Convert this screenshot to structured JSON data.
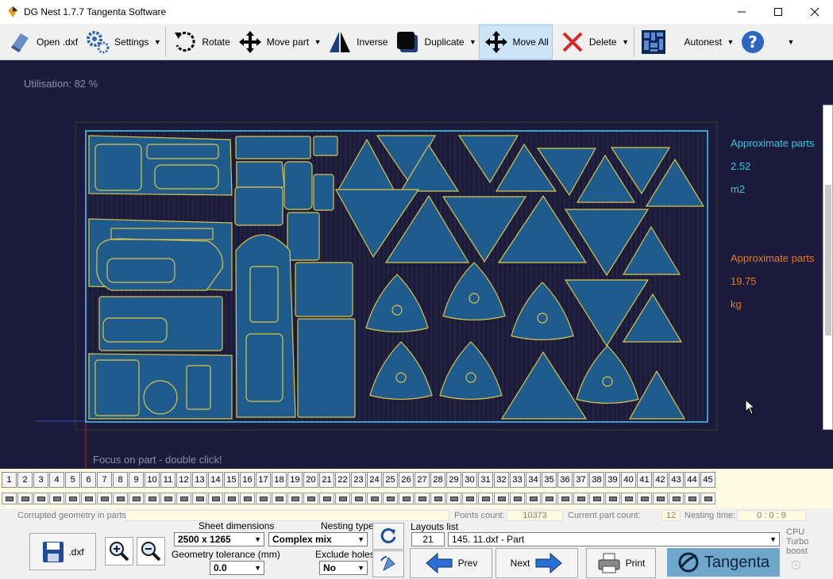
{
  "window": {
    "title": "DG Nest 1.7.7   Tangenta Software",
    "minimize_icon": "minimize-icon",
    "maximize_icon": "maximize-icon",
    "close_icon": "close-icon"
  },
  "toolbar": {
    "open_label": "Open .dxf",
    "settings_label": "Settings",
    "rotate_label": "Rotate",
    "move_part_label": "Move part",
    "inverse_label": "Inverse",
    "duplicate_label": "Duplicate",
    "move_all_label": "Move All",
    "delete_label": "Delete",
    "autonest_label": "Autonest"
  },
  "canvas": {
    "utilisation": "Utilisation: 82 %",
    "focus_hint": "Focus on part - double click!",
    "area_label": "Approximate parts",
    "area_value": "2.52",
    "area_unit": "m2",
    "weight_label": "Approximate parts",
    "weight_value": "19.75",
    "weight_unit": "kg",
    "colors": {
      "background": "#1c1b3b",
      "sheet": "#3ba1c9",
      "part_fill": "#1f5c8d",
      "part_outline": "#d9c64a"
    }
  },
  "layouts": {
    "tabs": [
      "1",
      "2",
      "3",
      "4",
      "5",
      "6",
      "7",
      "8",
      "9",
      "10",
      "11",
      "12",
      "13",
      "14",
      "15",
      "16",
      "17",
      "18",
      "19",
      "20",
      "21",
      "22",
      "23",
      "24",
      "25",
      "26",
      "27",
      "28",
      "29",
      "30",
      "31",
      "32",
      "33",
      "34",
      "35",
      "36",
      "37",
      "38",
      "39",
      "40",
      "41",
      "42",
      "43",
      "44",
      "45"
    ]
  },
  "status": {
    "corrupted_label": "Corrupted geometry in parts:",
    "corrupted_value": "",
    "points_label": "Points count:",
    "points_value": "10373",
    "part_count_label": "Current part count:",
    "part_count_value": "12",
    "nesting_time_label": "Nesting time:",
    "nesting_time_value": "0 : 0 : 9"
  },
  "bottom": {
    "save_label": ".dxf",
    "sheet_dimensions_label": "Sheet dimensions",
    "sheet_dimensions_value": "2500 x 1265",
    "geometry_tolerance_label": "Geometry tolerance (mm)",
    "geometry_tolerance_value": "0.0",
    "nesting_type_label": "Nesting type",
    "nesting_type_value": "Complex mix",
    "exclude_holes_label": "Exclude holes",
    "exclude_holes_value": "No",
    "layouts_list_label": "Layouts list",
    "layout_number": "21",
    "layout_name": "145. 11.dxf - Part",
    "prev_label": "Prev",
    "next_label": "Next",
    "print_label": "Print",
    "brand_label": "Tangenta",
    "cpu_label_1": "CPU",
    "cpu_label_2": "Turbo",
    "cpu_label_3": "boost"
  }
}
